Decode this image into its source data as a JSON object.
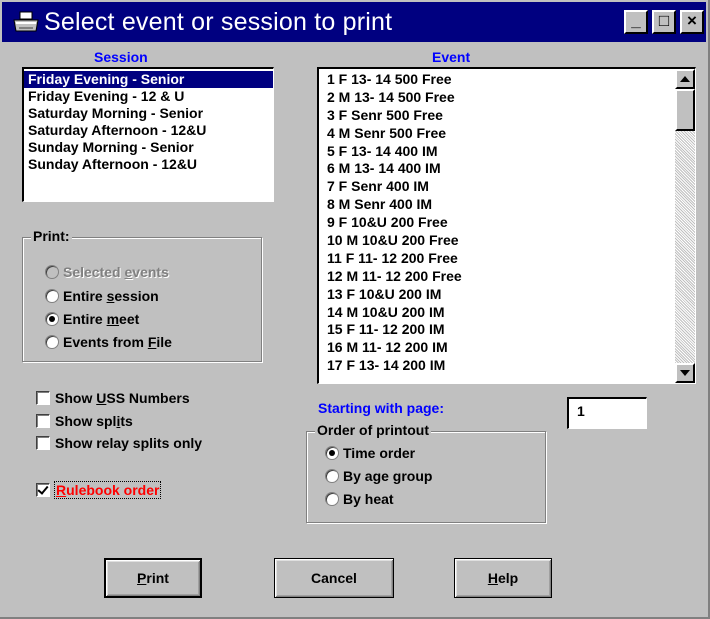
{
  "window": {
    "title": "Select event or session to print",
    "controls": [
      "_",
      "□",
      "×"
    ]
  },
  "session": {
    "label": "Session",
    "items": [
      "Friday Evening - Senior",
      "Friday Evening - 12 & U",
      "Saturday Morning - Senior",
      "Saturday Afternoon - 12&U",
      "Sunday Morning - Senior",
      "Sunday Afternoon - 12&U"
    ],
    "selected_index": 0
  },
  "event": {
    "label": "Event",
    "items": [
      "1 F 13- 14 500 Free",
      "2 M 13- 14 500 Free",
      "3 F Senr 500 Free",
      "4 M Senr 500 Free",
      "5 F 13- 14 400 IM",
      "6 M 13- 14 400 IM",
      "7 F Senr 400 IM",
      "8 M Senr 400 IM",
      "9 F 10&U 200 Free",
      "10 M 10&U 200 Free",
      "11 F 11- 12 200 Free",
      "12 M 11- 12 200 Free",
      "13 F 10&U 200 IM",
      "14 M 10&U 200 IM",
      "15 F 11- 12 200 IM",
      "16 M 11- 12 200 IM",
      "17 F 13- 14 200 IM"
    ]
  },
  "print_group": {
    "title": "Print:",
    "options": [
      {
        "pre": "Selected ",
        "key": "e",
        "post": "vents",
        "disabled": true,
        "checked": false
      },
      {
        "pre": "Entire ",
        "key": "s",
        "post": "ession",
        "disabled": false,
        "checked": false
      },
      {
        "pre": "Entire ",
        "key": "m",
        "post": "eet",
        "disabled": false,
        "checked": true
      },
      {
        "pre": "Events from ",
        "key": "F",
        "post": "ile",
        "disabled": false,
        "checked": false
      }
    ]
  },
  "checkboxes": {
    "show_uss": {
      "pre": "Show ",
      "key": "U",
      "post": "SS Numbers",
      "checked": false
    },
    "show_splits": {
      "pre": "Show spl",
      "key": "i",
      "post": "ts",
      "checked": false
    },
    "show_relay": {
      "pre": "Show relay splits only",
      "key": "",
      "post": "",
      "checked": false
    },
    "rulebook": {
      "pre": "",
      "key": "R",
      "post": "ulebook order",
      "checked": true
    }
  },
  "starting_page": {
    "label": "Starting with page:",
    "value": "1"
  },
  "order_group": {
    "title": "Order of printout",
    "options": [
      {
        "label": "Time order",
        "checked": true
      },
      {
        "label": "By age group",
        "checked": false
      },
      {
        "label": "By heat",
        "checked": false
      }
    ]
  },
  "buttons": {
    "print": {
      "pre": "",
      "key": "P",
      "post": "rint"
    },
    "cancel": {
      "pre": "Cancel",
      "key": "",
      "post": ""
    },
    "help": {
      "pre": "",
      "key": "H",
      "post": "elp"
    }
  },
  "colors": {
    "titlebar": "#000080",
    "label_blue": "#0000ff",
    "selection": "#000080",
    "rulebook_red": "#ff0000"
  }
}
